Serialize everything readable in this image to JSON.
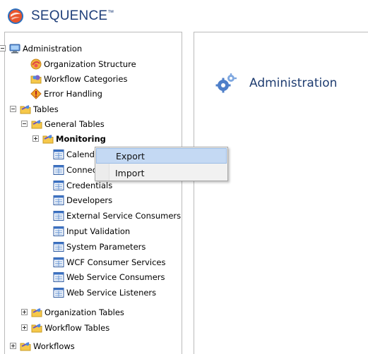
{
  "app": {
    "title": "SEQUENCE",
    "trademark": "™"
  },
  "tree": {
    "root": "Administration",
    "admin_children": [
      "Organization Structure",
      "Workflow Categories",
      "Error Handling"
    ],
    "tables": "Tables",
    "general_tables": "General Tables",
    "monitoring": "Monitoring",
    "general_items": [
      "Calendars",
      "Connections",
      "Credentials",
      "Developers",
      "External Service Consumers",
      "Input Validation",
      "System Parameters",
      "WCF Consumer Services",
      "Web Service Consumers",
      "Web Service Listeners"
    ],
    "organization_tables": "Organization Tables",
    "workflow_tables": "Workflow Tables",
    "workflows": "Workflows"
  },
  "context_menu": {
    "items": [
      "Export",
      "Import"
    ],
    "highlighted": "Export"
  },
  "content": {
    "header_title": "Administration"
  }
}
